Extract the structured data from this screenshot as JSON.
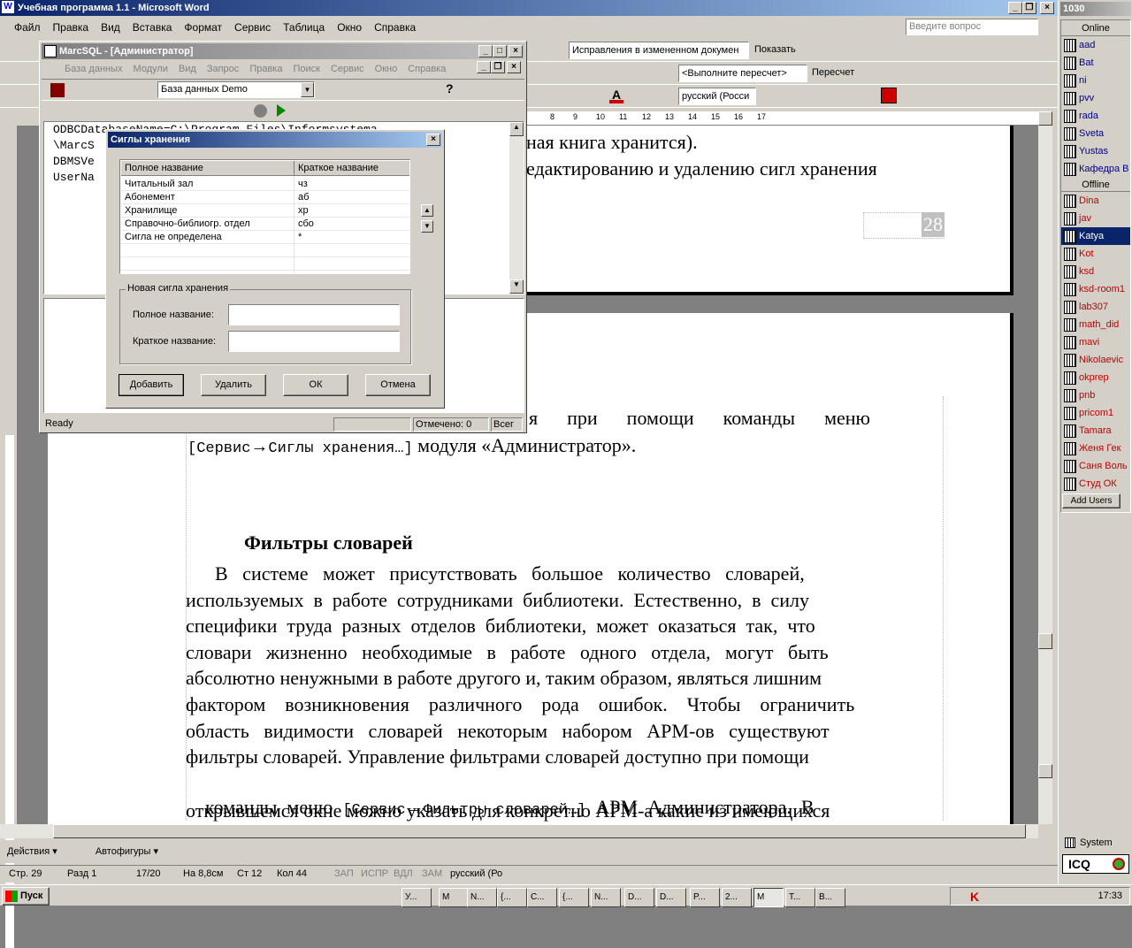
{
  "word": {
    "title": "Учебная программа 1.1 - Microsoft Word",
    "menu": [
      "Файл",
      "Правка",
      "Вид",
      "Вставка",
      "Формат",
      "Сервис",
      "Таблица",
      "Окно",
      "Справка"
    ],
    "help_placeholder": "Введите вопрос",
    "track_changes": "Исправления в измененном докумен",
    "show_label": "Показать",
    "recalc": "<Выполните пересчет>",
    "recount": "Пересчет",
    "language": "русский (Росси",
    "ruler_ticks": [
      "8",
      "9",
      "10",
      "11",
      "12",
      "13",
      "14",
      "15",
      "16",
      "17"
    ],
    "page_number": "28",
    "status": {
      "page": "Стр. 29",
      "section": "Разд 1",
      "pages": "17/20",
      "at": "На 8,8см",
      "line": "Ст 12",
      "col": "Кол 44",
      "rec": "ЗАП",
      "trk": "ИСПР",
      "ext": "ВДЛ",
      "ovr": "ЗАМ",
      "lang": "русский (Ро"
    },
    "draw_actions": "Действия",
    "draw_autoshapes": "Автофигуры",
    "doc": {
      "line_top1": "ная книга хранится).",
      "line_top2": "едактированию и удалению сигл хранения",
      "line_cmd_a": "я      при      помощи      команды      меню",
      "line_cmd_b1": "[Сервис",
      "line_cmd_b2": "Сиглы хранения…]",
      "line_cmd_b3": " модуля «Администратор».",
      "heading": "Фильтры словарей",
      "para": [
        "      В   системе   может   присутствовать   большое   количество   словарей,",
        "используемых  в  работе  сотрудниками  библиотеки.  Естественно,  в  силу",
        "специфики  труда  разных  отделов  библиотеки,  может  оказаться  так,  что",
        "словари   жизненно   необходимые   в   работе   одного   отдела,   могут   быть",
        "абсолютно ненужными в работе другого и, таким образом, являться лишним",
        "фактором    возникновения    различного    рода    ошибок.    Чтобы    ограничить",
        "область   видимости   словарей   некоторым   набором   АРМ-ов   существуют",
        "фильтры словарей. Управление фильтрами словарей доступно при помощи"
      ],
      "line_menu_a": "команды  меню  ",
      "line_menu_b": "[Сервис",
      "line_menu_c": "Фильтры словарей…]",
      "line_menu_d": "  АРМ  Администратора.  В",
      "line_last": "открывшемся окне можно указать для конкретно АРМ-а какие из имеющихся"
    }
  },
  "marc": {
    "title": "MarcSQL - [Администратор]",
    "menu": [
      "База данных",
      "Модули",
      "Вид",
      "Запрос",
      "Правка",
      "Поиск",
      "Сервис",
      "Окно",
      "Справка"
    ],
    "db_combo": "База данных Demo",
    "text_lines": [
      "ODBCDatabaseName=C:\\Program Files\\Informsystema",
      "\\MarcS",
      "DBMSVe",
      "UserNa"
    ],
    "status_ready": "Ready",
    "status_marked": "Отмечено: 0",
    "status_total": "Всег"
  },
  "dialog": {
    "title": "Сиглы хранения",
    "col_full": "Полное название",
    "col_short": "Краткое название",
    "rows": [
      {
        "full": "Читальный зал",
        "short": "чз"
      },
      {
        "full": "Абонемент",
        "short": "аб"
      },
      {
        "full": "Хранилище",
        "short": "хр"
      },
      {
        "full": "Справочно-библиогр. отдел",
        "short": "сбо"
      },
      {
        "full": "Сигла не определена",
        "short": "*"
      }
    ],
    "group_label": "Новая сигла хранения",
    "full_label": "Полное название:",
    "short_label": "Краткое название:",
    "btn_add": "Добавить",
    "btn_delete": "Удалить",
    "btn_ok": "ОК",
    "btn_cancel": "Отмена"
  },
  "icq": {
    "header": "1030",
    "online_label": "Online",
    "online": [
      "aad",
      "Bat",
      "ni",
      "pvv",
      "rada",
      "Sveta",
      "Yustas",
      "Кафедра В"
    ],
    "offline_label": "Offline",
    "offline": [
      "Dina",
      "jav",
      "Katya",
      "Kot",
      "ksd",
      "ksd-room1",
      "lab307",
      "math_did",
      "mavi",
      "Nikolaevic",
      "okprep",
      "pnb",
      "pricom1",
      "Tamara",
      "Женя Гек",
      "Саня Воль",
      "Студ ОК"
    ],
    "selected": "Katya",
    "add_users": "Add Users",
    "system": "System",
    "logo": "ICQ"
  },
  "taskbar": {
    "start": "Пуск",
    "clock": "17:33",
    "items": [
      "У...",
      "М",
      "N...",
      "{...",
      "C...",
      "{...",
      "N...",
      "D...",
      "D...",
      "P...",
      "2...",
      "M",
      "T...",
      "B..."
    ]
  }
}
